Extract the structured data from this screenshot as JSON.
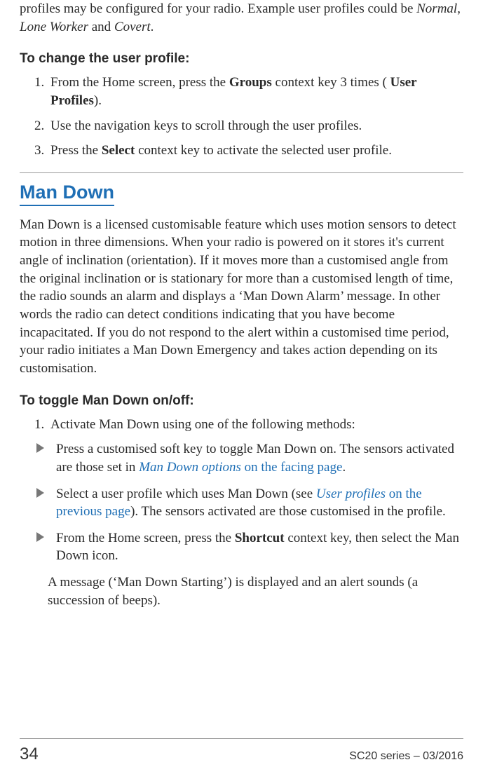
{
  "intro": {
    "line1": "profiles may be configured for your radio. Example user profiles could be ",
    "italic1": "Normal",
    "sep1": ", ",
    "italic2": "Lone Worker",
    "sep2": " and ",
    "italic3": "Covert",
    "end": "."
  },
  "change_profile": {
    "heading": "To change the user profile:",
    "steps": {
      "s1a": "From the Home screen, press the ",
      "s1b": "Groups",
      "s1c": " context key 3 times ( ",
      "s1d": "User Profiles",
      "s1e": ").",
      "s2": "Use the navigation keys to scroll through the user profiles.",
      "s3a": "Press the ",
      "s3b": "Select",
      "s3c": " context key to activate the selected user profile."
    }
  },
  "mandown": {
    "title": "Man Down",
    "para": "Man Down is a licensed customisable feature which uses motion sensors to detect motion in three dimensions. When your radio is powered on it stores it's current angle of inclination (orientation). If it moves more than a customised angle from the original inclination or is stationary for more than a customised length of time, the radio sounds an alarm and displays a ‘Man Down Alarm’ message. In other words the radio can detect conditions indicating that you have become incapacitated. If you do not respond to the alert within a customised time period, your radio initiates a Man Down Emergency and takes action depending on its customisation."
  },
  "toggle": {
    "heading": "To toggle Man Down on/off:",
    "step1": "Activate Man Down using one of the following methods:",
    "b1a": "Press a customised soft key to toggle Man Down on. The sensors activated are those set in ",
    "b1link_i": "Man Down options",
    "b1link_rest": " on the facing page",
    "b1end": ".",
    "b2a": "Select a user profile which uses Man Down (see ",
    "b2link_i": "User profiles",
    "b2link_rest": "  on the previous page",
    "b2b": "). The sensors activated are those customised in the profile.",
    "b3a": "From the Home screen, press the ",
    "b3b": "Shortcut",
    "b3c": " context key, then select the Man Down icon.",
    "after": "A message (‘Man Down Starting’) is displayed and an alert sounds (a succession of beeps)."
  },
  "footer": {
    "page": "34",
    "doc": "SC20 series – 03/2016"
  }
}
